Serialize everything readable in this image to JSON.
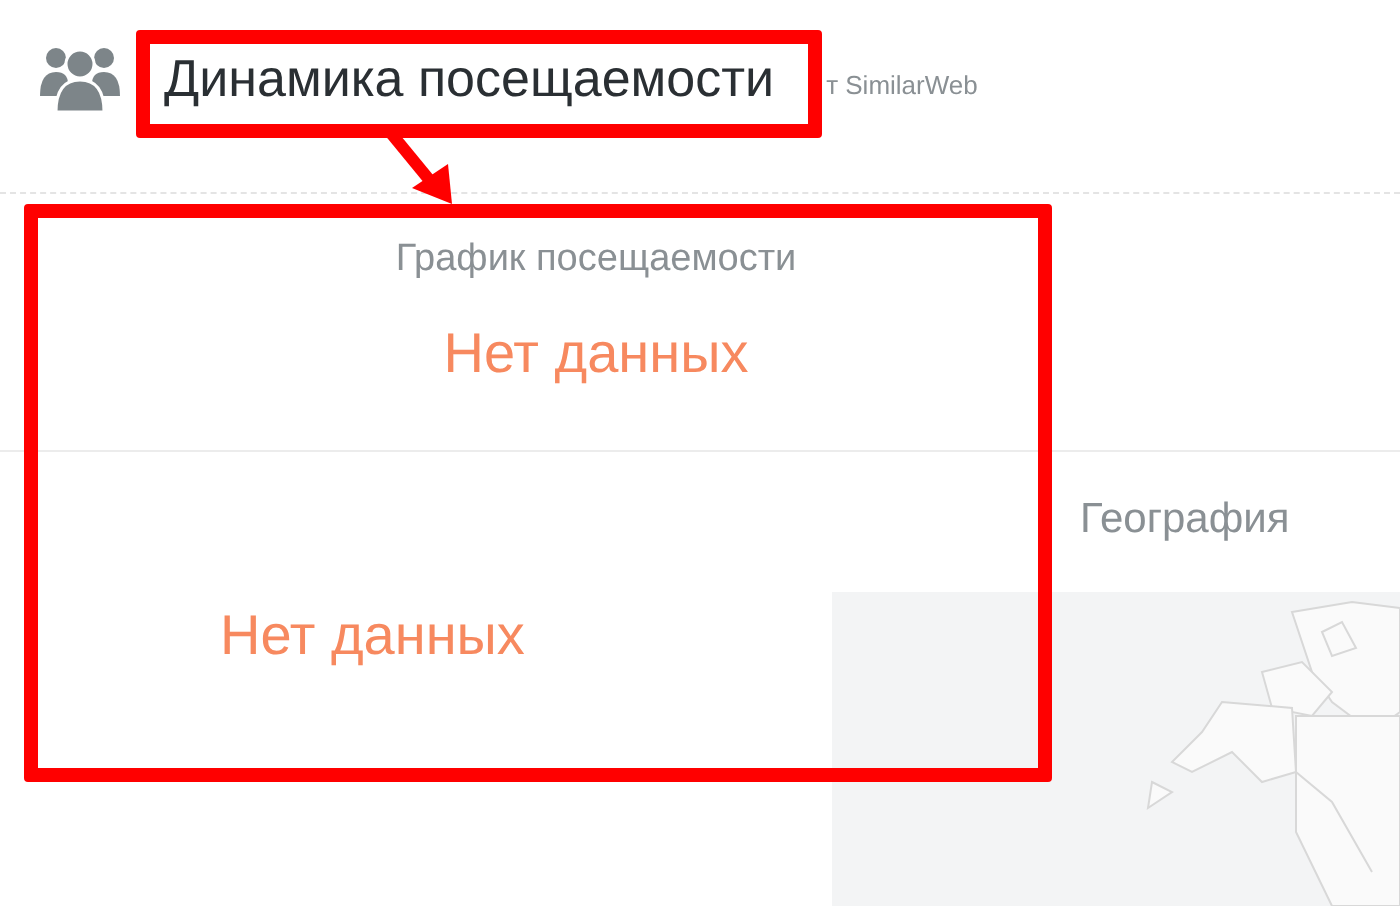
{
  "header": {
    "title": "Динамика посещаемости",
    "source": "т SimilarWeb"
  },
  "traffic_chart": {
    "title": "График посещаемости",
    "empty_message": "Нет данных"
  },
  "left_panel": {
    "empty_message": "Нет данных"
  },
  "geography": {
    "title": "География"
  }
}
